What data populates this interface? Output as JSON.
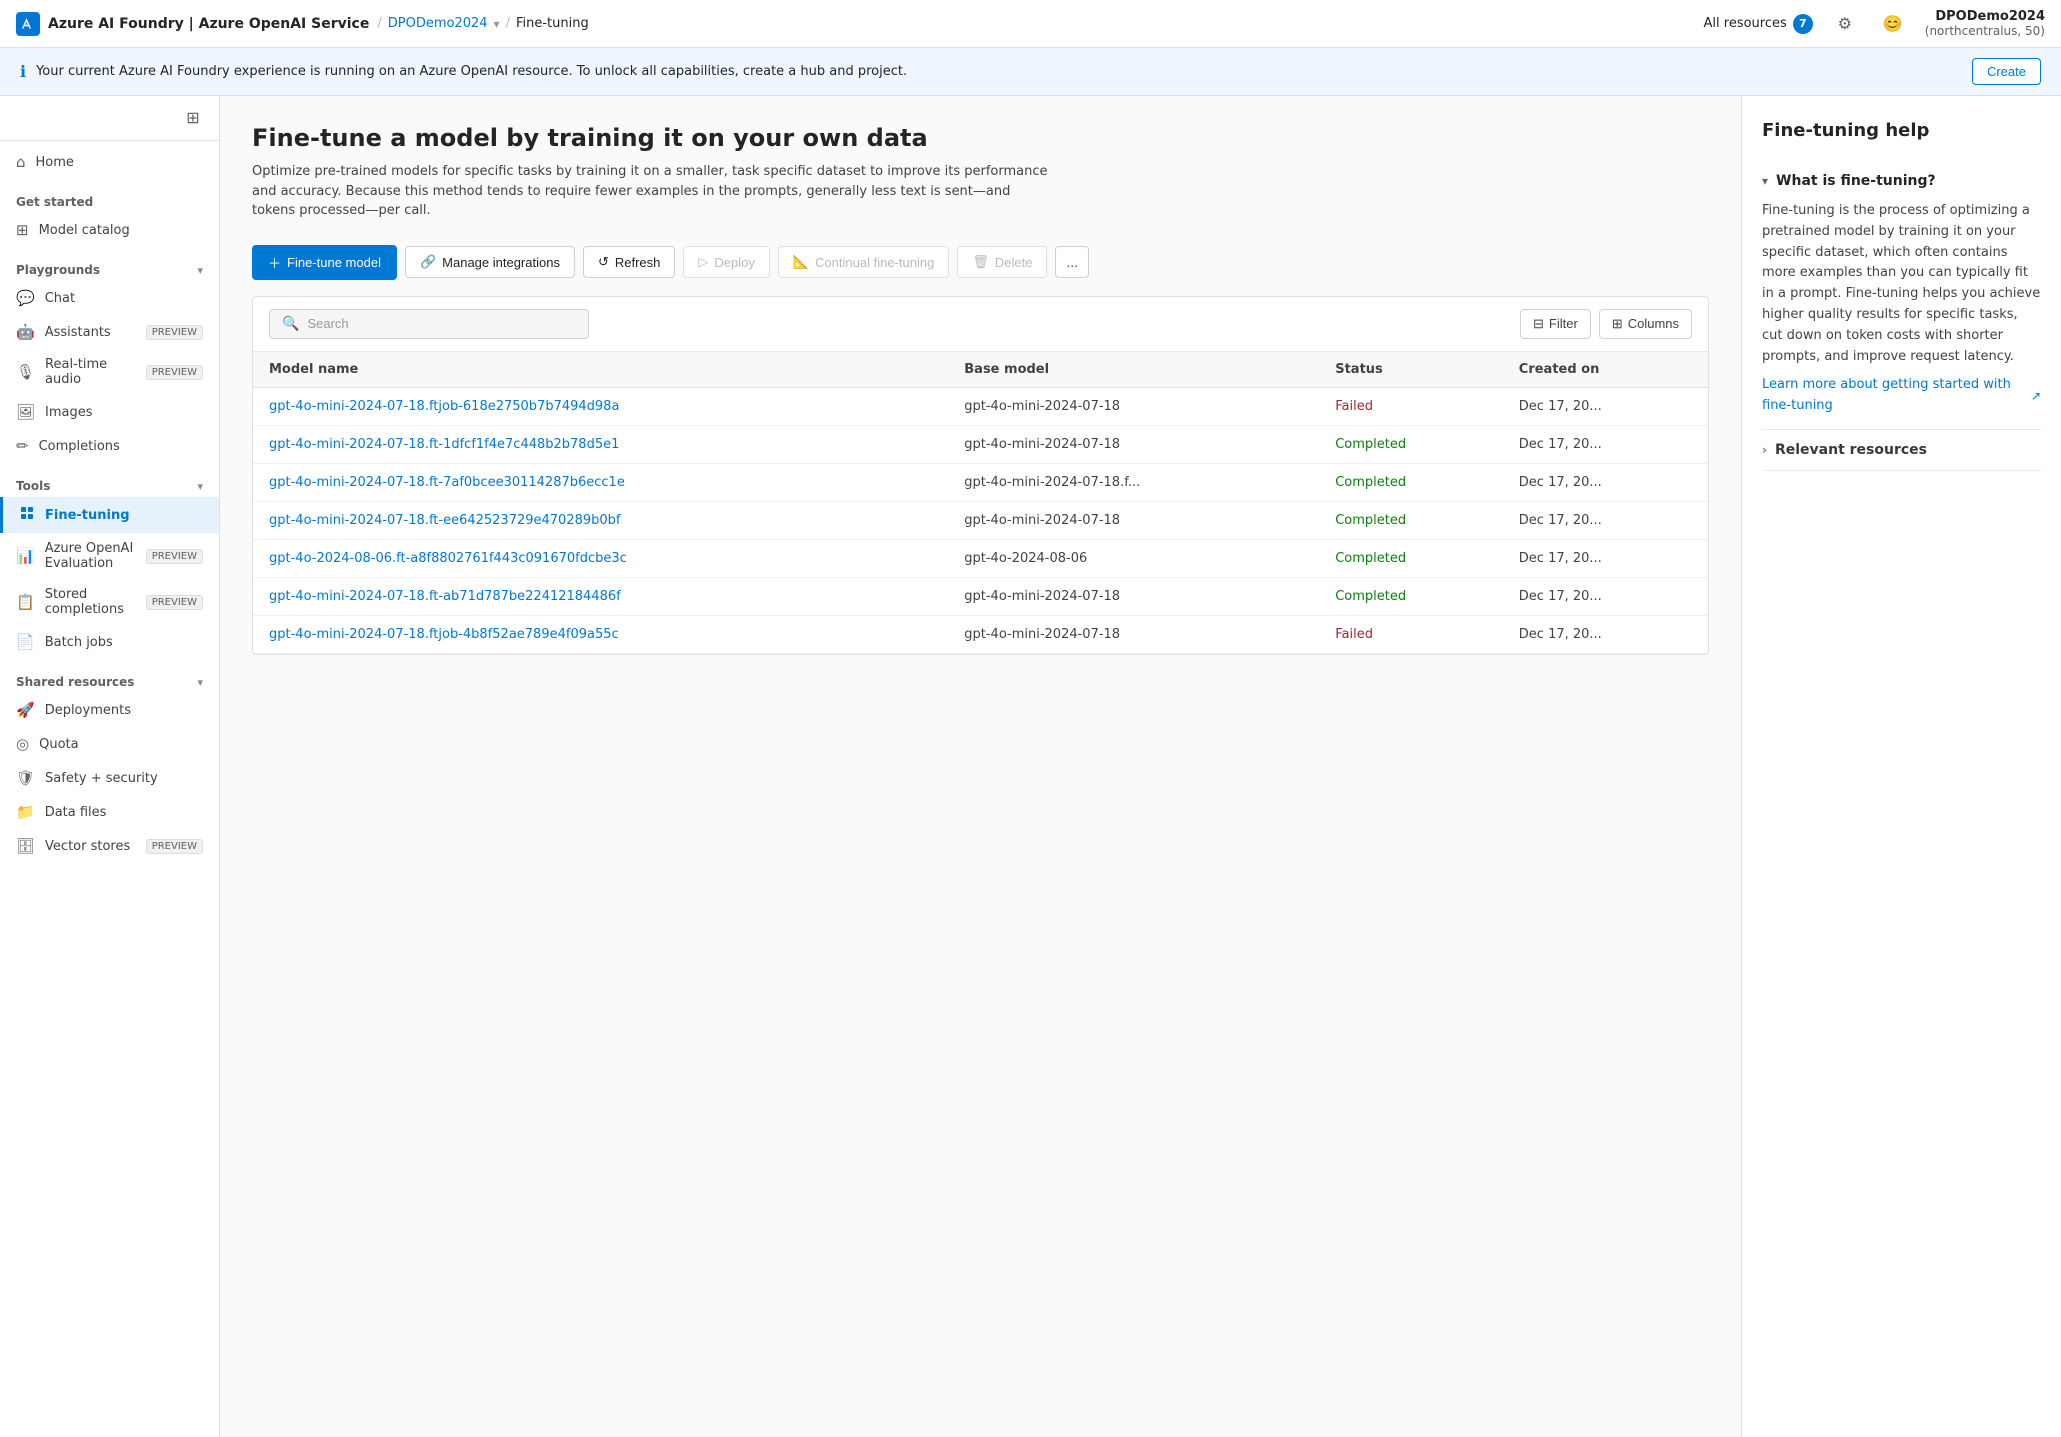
{
  "topbar": {
    "logo_icon": "AI",
    "app_name": "Azure AI Foundry | Azure OpenAI Service",
    "workspace": "DPODemo2024",
    "current_page": "Fine-tuning",
    "all_resources_label": "All resources",
    "resources_count": "7",
    "user_name": "DPODemo2024",
    "user_region": "(northcentralus, 50)"
  },
  "banner": {
    "text": "Your current Azure AI Foundry experience is running on an Azure OpenAI resource. To unlock all capabilities, create a hub and project.",
    "action_label": "Create"
  },
  "sidebar": {
    "toggle_icon": "☰",
    "home_label": "Home",
    "get_started_label": "Get started",
    "model_catalog_label": "Model catalog",
    "playgrounds_label": "Playgrounds",
    "playgrounds_expanded": true,
    "chat_label": "Chat",
    "assistants_label": "Assistants",
    "assistants_badge": "PREVIEW",
    "realtime_audio_label": "Real-time audio",
    "realtime_audio_badge": "PREVIEW",
    "images_label": "Images",
    "completions_label": "Completions",
    "tools_label": "Tools",
    "tools_expanded": true,
    "fine_tuning_label": "Fine-tuning",
    "azure_openai_eval_label": "Azure OpenAI Evaluation",
    "azure_openai_eval_badge": "PREVIEW",
    "stored_completions_label": "Stored completions",
    "stored_completions_badge": "PREVIEW",
    "batch_jobs_label": "Batch jobs",
    "shared_resources_label": "Shared resources",
    "shared_resources_expanded": true,
    "deployments_label": "Deployments",
    "quota_label": "Quota",
    "safety_security_label": "Safety + security",
    "data_files_label": "Data files",
    "vector_stores_label": "Vector stores",
    "vector_stores_badge": "PREVIEW"
  },
  "page": {
    "title": "Fine-tune a model by training it on your own data",
    "description": "Optimize pre-trained models for specific tasks by training it on a smaller, task specific dataset to improve its performance and accuracy. Because this method tends to require fewer examples in the prompts, generally less text is sent—and tokens processed—per call."
  },
  "toolbar": {
    "fine_tune_model": "+ Fine-tune model",
    "manage_integrations": "Manage integrations",
    "refresh": "Refresh",
    "deploy": "Deploy",
    "continual_fine_tuning": "Continual fine-tuning",
    "delete": "Delete",
    "more": "..."
  },
  "table": {
    "search_placeholder": "Search",
    "filter_label": "Filter",
    "columns_label": "Columns",
    "headers": [
      "Model name",
      "Base model",
      "Status",
      "Created on"
    ],
    "rows": [
      {
        "model_name": "gpt-4o-mini-2024-07-18.ftjob-618e2750b7b7494d98a",
        "base_model": "gpt-4o-mini-2024-07-18",
        "status": "Failed",
        "created_on": "Dec 17, 20..."
      },
      {
        "model_name": "gpt-4o-mini-2024-07-18.ft-1dfcf1f4e7c448b2b78d5e1",
        "base_model": "gpt-4o-mini-2024-07-18",
        "status": "Completed",
        "created_on": "Dec 17, 20..."
      },
      {
        "model_name": "gpt-4o-mini-2024-07-18.ft-7af0bcee30114287b6ecc1e",
        "base_model": "gpt-4o-mini-2024-07-18.f...",
        "status": "Completed",
        "created_on": "Dec 17, 20..."
      },
      {
        "model_name": "gpt-4o-mini-2024-07-18.ft-ee642523729e470289b0bf",
        "base_model": "gpt-4o-mini-2024-07-18",
        "status": "Completed",
        "created_on": "Dec 17, 20..."
      },
      {
        "model_name": "gpt-4o-2024-08-06.ft-a8f8802761f443c091670fdcbe3c",
        "base_model": "gpt-4o-2024-08-06",
        "status": "Completed",
        "created_on": "Dec 17, 20..."
      },
      {
        "model_name": "gpt-4o-mini-2024-07-18.ft-ab71d787be22412184486f",
        "base_model": "gpt-4o-mini-2024-07-18",
        "status": "Completed",
        "created_on": "Dec 17, 20..."
      },
      {
        "model_name": "gpt-4o-mini-2024-07-18.ftjob-4b8f52ae789e4f09a55c",
        "base_model": "gpt-4o-mini-2024-07-18",
        "status": "Failed",
        "created_on": "Dec 17, 20..."
      }
    ]
  },
  "right_panel": {
    "title": "Fine-tuning help",
    "accordion1_label": "What is fine-tuning?",
    "accordion1_expanded": true,
    "accordion1_content": "Fine-tuning is the process of optimizing a pretrained model by training it on your specific dataset, which often contains more examples than you can typically fit in a prompt. Fine-tuning helps you achieve higher quality results for specific tasks, cut down on token costs with shorter prompts, and improve request latency.",
    "accordion1_link": "Learn more about getting started with fine-tuning",
    "accordion2_label": "Relevant resources",
    "accordion2_expanded": false
  }
}
